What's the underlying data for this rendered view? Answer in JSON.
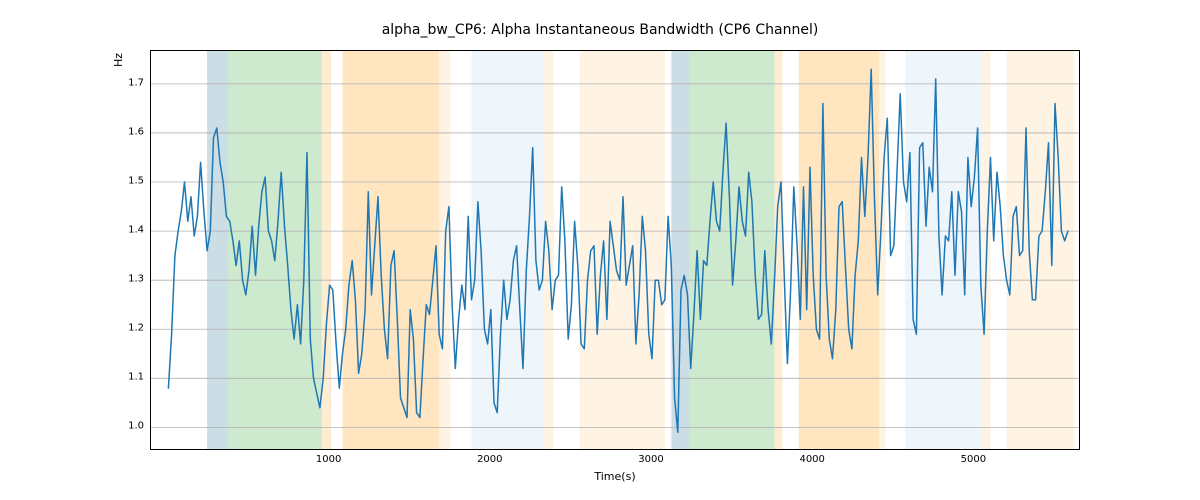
{
  "chart_data": {
    "type": "line",
    "title": "alpha_bw_CP6: Alpha Instantaneous Bandwidth (CP6 Channel)",
    "xlabel": "Time(s)",
    "ylabel": "Hz",
    "xlim": [
      -108,
      5649
    ],
    "ylim": [
      0.956,
      1.767
    ],
    "xticks": [
      1000,
      2000,
      3000,
      4000,
      5000
    ],
    "yticks": [
      1.0,
      1.1,
      1.2,
      1.3,
      1.4,
      1.5,
      1.6,
      1.7
    ],
    "bands": [
      {
        "x0": 240,
        "x1": 370,
        "color": "#6a9fb5"
      },
      {
        "x0": 370,
        "x1": 950,
        "color": "#6fbf73"
      },
      {
        "x0": 950,
        "x1": 1010,
        "color": "#ffcc80"
      },
      {
        "x0": 1080,
        "x1": 1680,
        "color": "#ffb74d"
      },
      {
        "x0": 1680,
        "x1": 1750,
        "color": "#ffe0b2"
      },
      {
        "x0": 1880,
        "x1": 2330,
        "color": "#cfe2f3"
      },
      {
        "x0": 2330,
        "x1": 2390,
        "color": "#ffe0b2"
      },
      {
        "x0": 2550,
        "x1": 3080,
        "color": "#ffe0b2"
      },
      {
        "x0": 3120,
        "x1": 3230,
        "color": "#6a9fb5"
      },
      {
        "x0": 3230,
        "x1": 3760,
        "color": "#6fbf73"
      },
      {
        "x0": 3760,
        "x1": 3810,
        "color": "#ffcc80"
      },
      {
        "x0": 3910,
        "x1": 4410,
        "color": "#ffb74d"
      },
      {
        "x0": 4410,
        "x1": 4450,
        "color": "#ffe0b2"
      },
      {
        "x0": 4570,
        "x1": 5050,
        "color": "#cfe2f3"
      },
      {
        "x0": 5050,
        "x1": 5100,
        "color": "#ffe0b2"
      },
      {
        "x0": 5200,
        "x1": 5620,
        "color": "#ffe0b2"
      }
    ],
    "series": [
      {
        "name": "alpha_bw_CP6",
        "x_start": 0,
        "x_step": 20,
        "values": [
          1.08,
          1.19,
          1.35,
          1.4,
          1.44,
          1.5,
          1.42,
          1.47,
          1.39,
          1.43,
          1.54,
          1.44,
          1.36,
          1.4,
          1.59,
          1.61,
          1.54,
          1.5,
          1.43,
          1.42,
          1.38,
          1.33,
          1.38,
          1.3,
          1.27,
          1.32,
          1.41,
          1.31,
          1.41,
          1.48,
          1.51,
          1.4,
          1.38,
          1.34,
          1.42,
          1.52,
          1.41,
          1.33,
          1.24,
          1.18,
          1.25,
          1.17,
          1.3,
          1.56,
          1.18,
          1.1,
          1.07,
          1.04,
          1.1,
          1.21,
          1.29,
          1.28,
          1.17,
          1.08,
          1.15,
          1.2,
          1.29,
          1.34,
          1.26,
          1.11,
          1.15,
          1.24,
          1.48,
          1.27,
          1.37,
          1.47,
          1.31,
          1.2,
          1.14,
          1.33,
          1.36,
          1.22,
          1.06,
          1.04,
          1.02,
          1.24,
          1.18,
          1.03,
          1.02,
          1.14,
          1.25,
          1.23,
          1.3,
          1.37,
          1.19,
          1.16,
          1.4,
          1.45,
          1.25,
          1.12,
          1.22,
          1.29,
          1.24,
          1.43,
          1.26,
          1.3,
          1.46,
          1.36,
          1.2,
          1.17,
          1.24,
          1.05,
          1.03,
          1.19,
          1.3,
          1.22,
          1.26,
          1.34,
          1.37,
          1.24,
          1.12,
          1.32,
          1.43,
          1.57,
          1.34,
          1.28,
          1.3,
          1.42,
          1.36,
          1.24,
          1.3,
          1.31,
          1.49,
          1.38,
          1.18,
          1.25,
          1.42,
          1.33,
          1.17,
          1.16,
          1.3,
          1.36,
          1.37,
          1.19,
          1.31,
          1.38,
          1.22,
          1.42,
          1.37,
          1.32,
          1.3,
          1.47,
          1.29,
          1.33,
          1.37,
          1.17,
          1.27,
          1.43,
          1.36,
          1.19,
          1.14,
          1.3,
          1.3,
          1.25,
          1.26,
          1.43,
          1.33,
          1.06,
          0.99,
          1.28,
          1.31,
          1.27,
          1.12,
          1.23,
          1.36,
          1.22,
          1.34,
          1.33,
          1.42,
          1.5,
          1.42,
          1.4,
          1.52,
          1.62,
          1.47,
          1.29,
          1.38,
          1.49,
          1.42,
          1.39,
          1.52,
          1.46,
          1.31,
          1.22,
          1.23,
          1.36,
          1.24,
          1.17,
          1.3,
          1.45,
          1.5,
          1.31,
          1.13,
          1.28,
          1.49,
          1.37,
          1.22,
          1.49,
          1.24,
          1.53,
          1.31,
          1.2,
          1.18,
          1.66,
          1.31,
          1.18,
          1.14,
          1.24,
          1.45,
          1.46,
          1.33,
          1.2,
          1.16,
          1.31,
          1.38,
          1.55,
          1.43,
          1.55,
          1.73,
          1.47,
          1.27,
          1.4,
          1.55,
          1.63,
          1.35,
          1.37,
          1.52,
          1.68,
          1.5,
          1.46,
          1.56,
          1.22,
          1.19,
          1.57,
          1.58,
          1.41,
          1.53,
          1.48,
          1.71,
          1.39,
          1.27,
          1.39,
          1.38,
          1.48,
          1.31,
          1.48,
          1.44,
          1.27,
          1.55,
          1.45,
          1.51,
          1.61,
          1.29,
          1.19,
          1.4,
          1.55,
          1.38,
          1.52,
          1.45,
          1.35,
          1.3,
          1.27,
          1.43,
          1.45,
          1.35,
          1.36,
          1.61,
          1.36,
          1.26,
          1.26,
          1.39,
          1.4,
          1.48,
          1.58,
          1.33,
          1.66,
          1.55,
          1.4,
          1.38,
          1.4
        ]
      }
    ]
  }
}
